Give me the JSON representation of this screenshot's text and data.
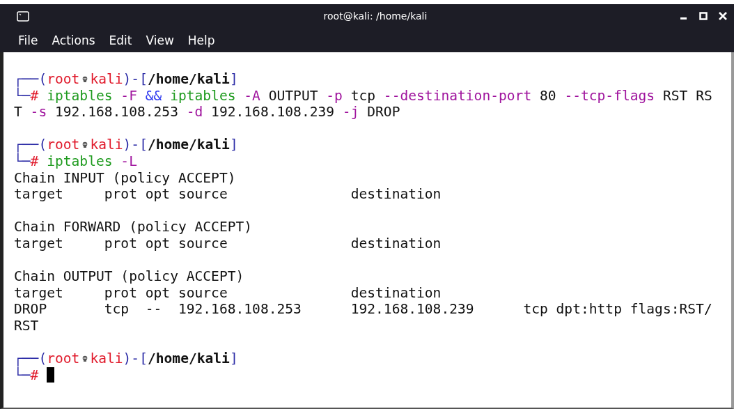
{
  "window": {
    "title": "root@kali: /home/kali"
  },
  "menu": [
    "File",
    "Actions",
    "Edit",
    "View",
    "Help"
  ],
  "terminal": {
    "sessions": [
      {
        "prompt": {
          "corner_top": "┌──(",
          "user": "root",
          "host": "kali",
          "sep": ")-[",
          "path": "/home/kali",
          "close": "]",
          "corner_bottom": "└─",
          "symbol": "#"
        },
        "command": [
          [
            {
              "kind": "cmd",
              "text": "iptables"
            },
            {
              "kind": "opt",
              "text": " -F"
            },
            {
              "kind": "op",
              "text": " &&"
            },
            {
              "kind": "cmd",
              "text": " iptables"
            },
            {
              "kind": "opt",
              "text": " -A"
            },
            {
              "kind": "arg",
              "text": " OUTPUT"
            },
            {
              "kind": "opt",
              "text": " -p"
            },
            {
              "kind": "arg",
              "text": " tcp"
            },
            {
              "kind": "opt",
              "text": " --destination-port"
            },
            {
              "kind": "arg",
              "text": " 80"
            },
            {
              "kind": "opt",
              "text": " --tcp-flags"
            },
            {
              "kind": "arg",
              "text": " RST RS"
            }
          ],
          [
            {
              "kind": "arg",
              "text": "T"
            },
            {
              "kind": "opt",
              "text": " -s"
            },
            {
              "kind": "arg",
              "text": " 192.168.108.253"
            },
            {
              "kind": "opt",
              "text": " -d"
            },
            {
              "kind": "arg",
              "text": " 192.168.108.239"
            },
            {
              "kind": "opt",
              "text": " -j"
            },
            {
              "kind": "arg",
              "text": " DROP"
            }
          ]
        ],
        "cursor": false
      },
      {
        "prompt": {
          "corner_top": "┌──(",
          "user": "root",
          "host": "kali",
          "sep": ")-[",
          "path": "/home/kali",
          "close": "]",
          "corner_bottom": "└─",
          "symbol": "#"
        },
        "command": [
          [
            {
              "kind": "cmd",
              "text": "iptables"
            },
            {
              "kind": "opt",
              "text": " -L"
            }
          ]
        ],
        "output": [
          [
            "Chain INPUT (policy ACCEPT)",
            "target     prot opt source               destination"
          ],
          [
            "Chain FORWARD (policy ACCEPT)",
            "target     prot opt source               destination"
          ],
          [
            "Chain OUTPUT (policy ACCEPT)",
            "target     prot opt source               destination",
            "DROP       tcp  --  192.168.108.253      192.168.108.239      tcp dpt:http flags:RST/",
            "RST"
          ]
        ],
        "cursor": false
      },
      {
        "prompt": {
          "corner_top": "┌──(",
          "user": "root",
          "host": "kali",
          "sep": ")-[",
          "path": "/home/kali",
          "close": "]",
          "corner_bottom": "└─",
          "symbol": "#"
        },
        "cursor": true
      }
    ]
  }
}
